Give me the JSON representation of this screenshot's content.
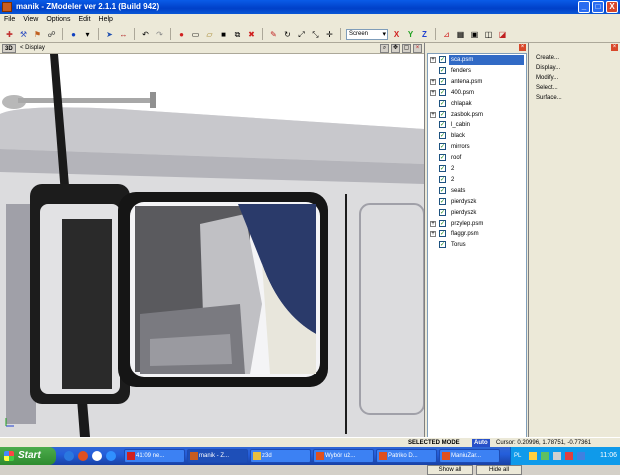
{
  "window": {
    "title": "manik - ZModeler ver 2.1.1 (Build 942)",
    "buttons": [
      "_",
      "□",
      "X"
    ]
  },
  "menu": [
    "File",
    "View",
    "Options",
    "Edit",
    "Help"
  ],
  "toolbar": {
    "screen_select_value": "Screen",
    "axis_labels": [
      "X",
      "Y",
      "Z"
    ]
  },
  "viewport": {
    "mode_tag": "3D",
    "display_label": "< Display"
  },
  "tree": {
    "items": [
      {
        "label": "sca.psm",
        "expandable": true,
        "selected": true
      },
      {
        "label": "fenders",
        "expandable": false
      },
      {
        "label": "antena.psm",
        "expandable": true
      },
      {
        "label": "400.psm",
        "expandable": true
      },
      {
        "label": "chlapak",
        "expandable": false
      },
      {
        "label": "zasbok.psm",
        "expandable": true
      },
      {
        "label": "l_cabin",
        "expandable": false
      },
      {
        "label": "black",
        "expandable": false
      },
      {
        "label": "mirrors",
        "expandable": false
      },
      {
        "label": "roof",
        "expandable": false
      },
      {
        "label": "2",
        "expandable": false
      },
      {
        "label": "2",
        "expandable": false
      },
      {
        "label": "seats",
        "expandable": false
      },
      {
        "label": "pierdyszk",
        "expandable": false
      },
      {
        "label": "pierdyszk",
        "expandable": false
      },
      {
        "label": "przylep.psm",
        "expandable": true
      },
      {
        "label": "flaggr.psm",
        "expandable": true
      },
      {
        "label": "Torus",
        "expandable": false
      }
    ],
    "show_all": "Show all",
    "hide_all": "Hide all"
  },
  "commands": [
    "Create...",
    "Display...",
    "Modify...",
    "Select...",
    "Surface..."
  ],
  "status": {
    "mode": "SELECTED MODE",
    "auto": "Auto",
    "cursor": "Cursor: 0.20996, 1.78751, -0.77361"
  },
  "taskbar": {
    "start": "Start",
    "tasks": [
      "41:09 ne...",
      "manik - Z...",
      "z3d",
      "Wybór uż...",
      "Patriko D...",
      "ManiuZar..."
    ],
    "clock": "11:06",
    "lang": "PL"
  },
  "colors": {
    "accent": "#316ac5",
    "titlebar": "#0a5ce8",
    "taskbar": "#245edb",
    "start": "#2e8b2e"
  }
}
